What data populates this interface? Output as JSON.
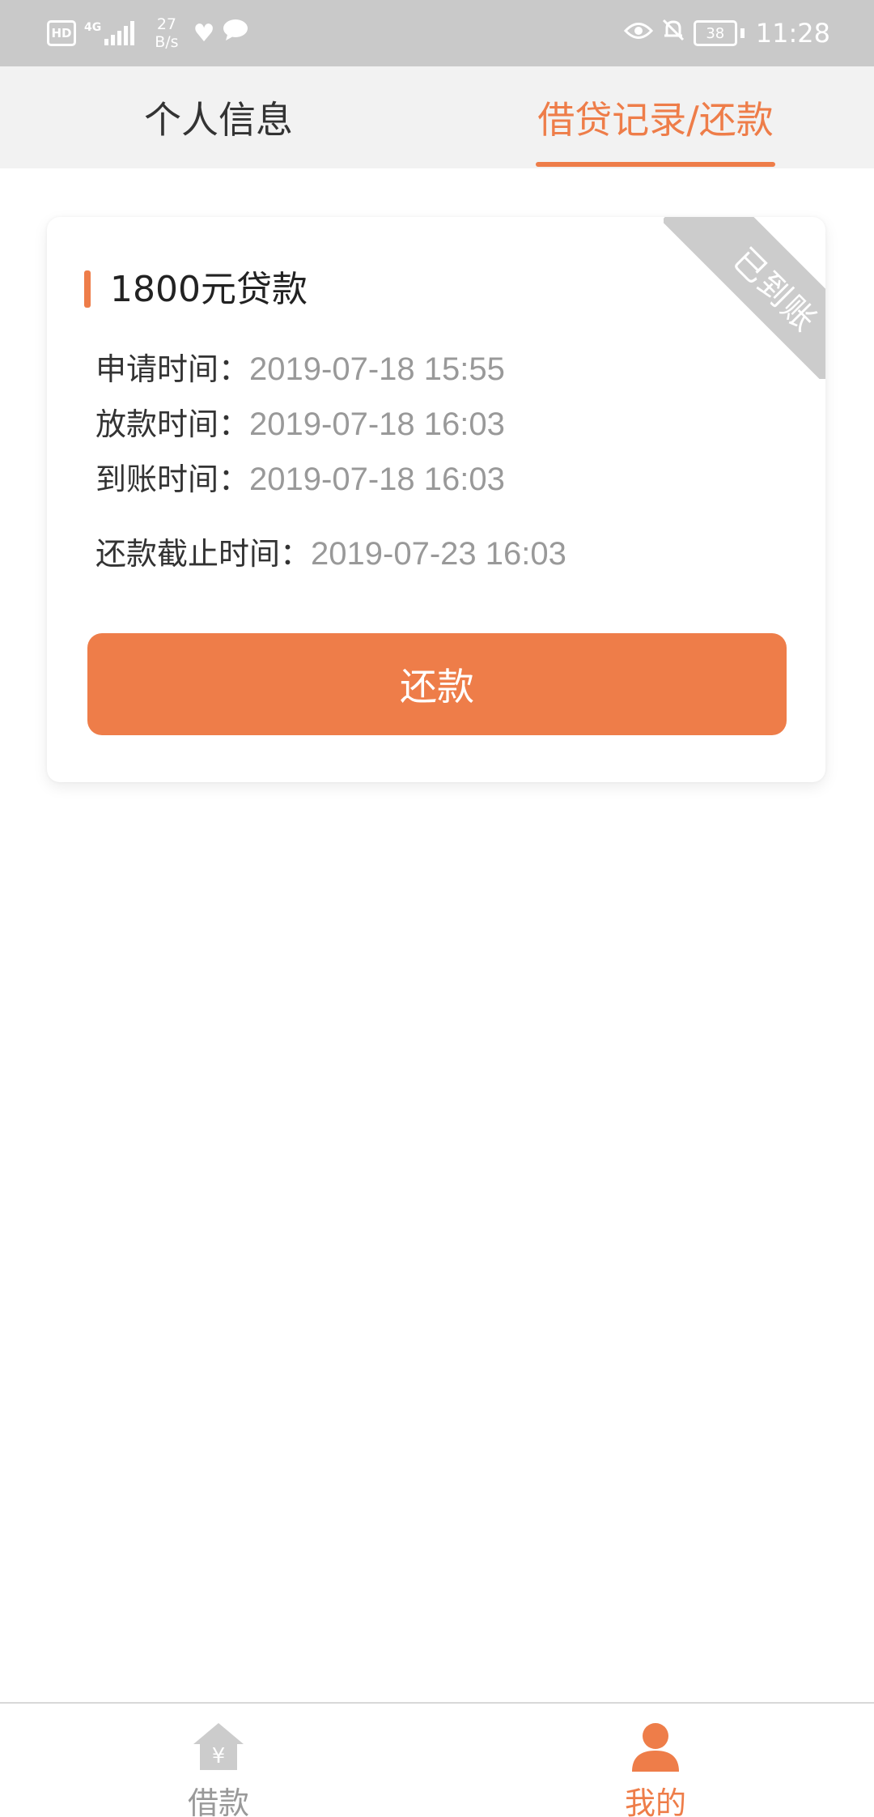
{
  "status_bar": {
    "hd": "HD",
    "network": "4G",
    "speed_value": "27",
    "speed_unit": "B/s",
    "battery": "38",
    "time": "11:28"
  },
  "tabs": [
    {
      "label": "个人信息",
      "active": false
    },
    {
      "label": "借贷记录/还款",
      "active": true
    }
  ],
  "loan_card": {
    "title": "1800元贷款",
    "status_ribbon": "已到账",
    "rows": [
      {
        "label": "申请时间：",
        "value": "2019-07-18 15:55"
      },
      {
        "label": "放款时间：",
        "value": "2019-07-18 16:03"
      },
      {
        "label": "到账时间：",
        "value": "2019-07-18 16:03"
      },
      {
        "label": "还款截止时间：",
        "value": "2019-07-23 16:03"
      }
    ],
    "repay_button": "还款"
  },
  "bottom_nav": [
    {
      "label": "借款",
      "icon": "house-yen-icon",
      "active": false
    },
    {
      "label": "我的",
      "icon": "user-icon",
      "active": true
    }
  ],
  "colors": {
    "accent": "#ee7d49",
    "muted": "#999999",
    "ribbon": "#cccccc",
    "status_bar": "#c9c9c9"
  }
}
